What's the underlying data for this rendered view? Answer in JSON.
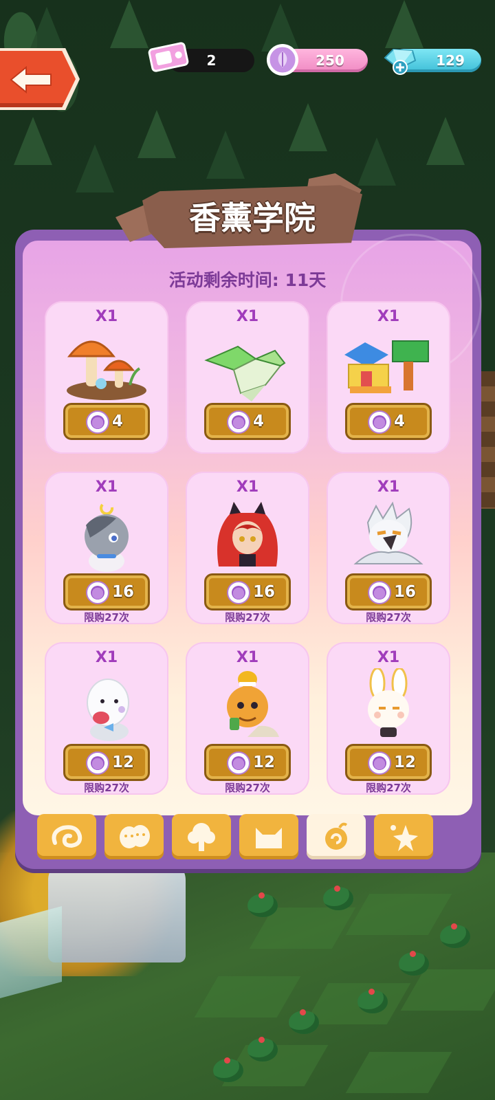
{
  "header": {
    "ticket_count": "2",
    "feather_count": "250",
    "gem_count": "129"
  },
  "panel": {
    "title": "香薰学院",
    "timer_text": "活动剩余时间: 11天"
  },
  "shop_items": [
    {
      "qty": "X1",
      "price": "4",
      "icon": "mushroom-decor-icon",
      "limit": ""
    },
    {
      "qty": "X1",
      "price": "4",
      "icon": "origami-frog-icon",
      "limit": ""
    },
    {
      "qty": "X1",
      "price": "4",
      "icon": "block-house-icon",
      "limit": ""
    },
    {
      "qty": "X1",
      "price": "16",
      "icon": "raccoon-character-icon",
      "limit": "限购27次"
    },
    {
      "qty": "X1",
      "price": "16",
      "icon": "red-hair-cat-girl-icon",
      "limit": "限购27次"
    },
    {
      "qty": "X1",
      "price": "16",
      "icon": "white-bird-character-icon",
      "limit": "限购27次"
    },
    {
      "qty": "X1",
      "price": "12",
      "icon": "white-chick-character-icon",
      "limit": "限购27次"
    },
    {
      "qty": "X1",
      "price": "12",
      "icon": "orange-duck-character-icon",
      "limit": "限购27次"
    },
    {
      "qty": "X1",
      "price": "12",
      "icon": "bunny-character-icon",
      "limit": "限购27次"
    }
  ],
  "tabs": [
    {
      "icon": "swirl-cloud-icon",
      "active": false
    },
    {
      "icon": "masks-icon",
      "active": false
    },
    {
      "icon": "tree-icon",
      "active": false
    },
    {
      "icon": "cat-face-icon",
      "active": false
    },
    {
      "icon": "snail-swirl-icon",
      "active": true
    },
    {
      "icon": "star-sparkle-icon",
      "active": false
    }
  ],
  "colors": {
    "panel_border": "#8e5fb4",
    "card_bg": "#fbd9f6",
    "price_button": "#c88a1d",
    "tab_normal": "#f1b43e",
    "tab_active": "#fff3e0",
    "text_purple": "#7c3a97"
  }
}
